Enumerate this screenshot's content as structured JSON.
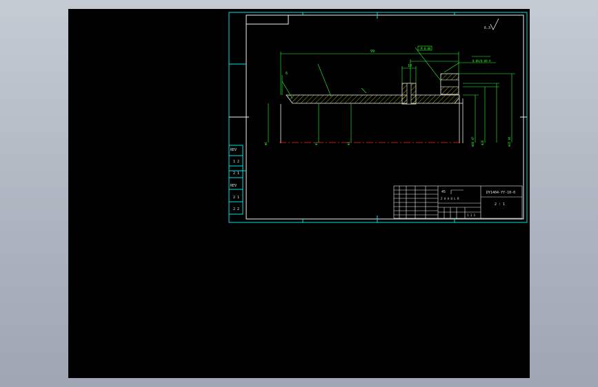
{
  "drawing": {
    "title_block": {
      "drawing_number": "DY1404-YY-10-0",
      "material_line": "45",
      "name_line": "Z A A U L R",
      "scale_label": "2 : 1",
      "sheet_label": "1 1 1"
    },
    "dimensions": {
      "overall_length": "99",
      "roughness_note": "6.3",
      "chamfer_top": "6",
      "hole_dim": "10",
      "top_tol_label": "M  0.08",
      "right_tol_label": "0.08/0.08-A",
      "left_dia_1": "Φ6",
      "left_dia_2": "Φ5",
      "mid_dia": "Φ4",
      "right_dia_1": "Φ40 H7",
      "right_dia_2": "Φ26",
      "right_dia_3": "Φ35 k6"
    },
    "revision_rows": [
      "REV",
      "1 2",
      "2 1",
      "REV",
      "2 1",
      "2 2"
    ],
    "colors": {
      "frame": "#00e5e5",
      "outline": "#f2f2f2",
      "dimension": "#33ff33",
      "centerline": "#ff2020",
      "hatch": "#e8e800"
    }
  }
}
